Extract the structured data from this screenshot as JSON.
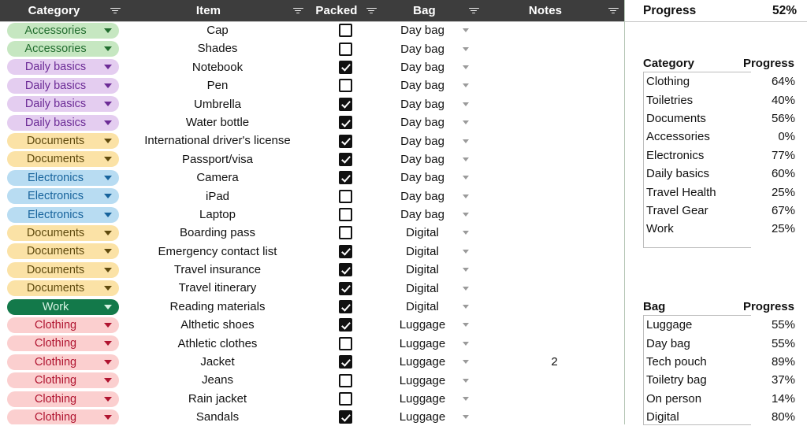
{
  "table": {
    "columns": [
      {
        "key": "category",
        "label": "Category",
        "filter_icon": "filter-icon"
      },
      {
        "key": "item",
        "label": "Item",
        "filter_icon": "filter-icon"
      },
      {
        "key": "packed",
        "label": "Packed",
        "filter_icon": "filter-icon"
      },
      {
        "key": "bag",
        "label": "Bag",
        "filter_icon": "filter-icon"
      },
      {
        "key": "notes",
        "label": "Notes",
        "filter_icon": "filter-icon"
      }
    ],
    "category_colors": {
      "Accessories": {
        "bg": "#c6e7c1",
        "fg": "#216c2e"
      },
      "Daily basics": {
        "bg": "#e4cdf0",
        "fg": "#6c2b96"
      },
      "Documents": {
        "bg": "#fbe2a6",
        "fg": "#5f4a0e"
      },
      "Electronics": {
        "bg": "#b8dcf2",
        "fg": "#17639c"
      },
      "Work": {
        "bg": "#13794a",
        "fg": "#d8f3e3"
      },
      "Clothing": {
        "bg": "#fbcfcf",
        "fg": "#b01430"
      }
    },
    "rows": [
      {
        "category": "Accessories",
        "item": "Cap",
        "packed": false,
        "bag": "Day bag",
        "notes": ""
      },
      {
        "category": "Accessories",
        "item": "Shades",
        "packed": false,
        "bag": "Day bag",
        "notes": ""
      },
      {
        "category": "Daily basics",
        "item": "Notebook",
        "packed": true,
        "bag": "Day bag",
        "notes": ""
      },
      {
        "category": "Daily basics",
        "item": "Pen",
        "packed": false,
        "bag": "Day bag",
        "notes": ""
      },
      {
        "category": "Daily basics",
        "item": "Umbrella",
        "packed": true,
        "bag": "Day bag",
        "notes": ""
      },
      {
        "category": "Daily basics",
        "item": "Water bottle",
        "packed": true,
        "bag": "Day bag",
        "notes": ""
      },
      {
        "category": "Documents",
        "item": "International driver's license",
        "packed": true,
        "bag": "Day bag",
        "notes": ""
      },
      {
        "category": "Documents",
        "item": "Passport/visa",
        "packed": true,
        "bag": "Day bag",
        "notes": ""
      },
      {
        "category": "Electronics",
        "item": "Camera",
        "packed": true,
        "bag": "Day bag",
        "notes": ""
      },
      {
        "category": "Electronics",
        "item": "iPad",
        "packed": false,
        "bag": "Day bag",
        "notes": ""
      },
      {
        "category": "Electronics",
        "item": "Laptop",
        "packed": false,
        "bag": "Day bag",
        "notes": ""
      },
      {
        "category": "Documents",
        "item": "Boarding pass",
        "packed": false,
        "bag": "Digital",
        "notes": ""
      },
      {
        "category": "Documents",
        "item": "Emergency contact list",
        "packed": true,
        "bag": "Digital",
        "notes": ""
      },
      {
        "category": "Documents",
        "item": "Travel insurance",
        "packed": true,
        "bag": "Digital",
        "notes": ""
      },
      {
        "category": "Documents",
        "item": "Travel itinerary",
        "packed": true,
        "bag": "Digital",
        "notes": ""
      },
      {
        "category": "Work",
        "item": "Reading materials",
        "packed": true,
        "bag": "Digital",
        "notes": ""
      },
      {
        "category": "Clothing",
        "item": "Althetic shoes",
        "packed": true,
        "bag": "Luggage",
        "notes": ""
      },
      {
        "category": "Clothing",
        "item": "Athletic clothes",
        "packed": false,
        "bag": "Luggage",
        "notes": ""
      },
      {
        "category": "Clothing",
        "item": "Jacket",
        "packed": true,
        "bag": "Luggage",
        "notes": "2"
      },
      {
        "category": "Clothing",
        "item": "Jeans",
        "packed": false,
        "bag": "Luggage",
        "notes": ""
      },
      {
        "category": "Clothing",
        "item": "Rain jacket",
        "packed": false,
        "bag": "Luggage",
        "notes": ""
      },
      {
        "category": "Clothing",
        "item": "Sandals",
        "packed": true,
        "bag": "Luggage",
        "notes": ""
      }
    ]
  },
  "panel": {
    "overall": {
      "label": "Progress",
      "value": "52%"
    },
    "category_summary": {
      "header": {
        "name": "Category",
        "progress": "Progress"
      },
      "rows": [
        {
          "name": "Clothing",
          "progress": "64%"
        },
        {
          "name": "Toiletries",
          "progress": "40%"
        },
        {
          "name": "Documents",
          "progress": "56%"
        },
        {
          "name": "Accessories",
          "progress": "0%"
        },
        {
          "name": "Electronics",
          "progress": "77%"
        },
        {
          "name": "Daily basics",
          "progress": "60%"
        },
        {
          "name": "Travel Health",
          "progress": "25%"
        },
        {
          "name": "Travel Gear",
          "progress": "67%"
        },
        {
          "name": "Work",
          "progress": "25%"
        }
      ]
    },
    "bag_summary": {
      "header": {
        "name": "Bag",
        "progress": "Progress"
      },
      "rows": [
        {
          "name": "Luggage",
          "progress": "55%"
        },
        {
          "name": "Day bag",
          "progress": "55%"
        },
        {
          "name": "Tech pouch",
          "progress": "89%"
        },
        {
          "name": "Toiletry bag",
          "progress": "37%"
        },
        {
          "name": "On person",
          "progress": "14%"
        },
        {
          "name": "Digital",
          "progress": "80%"
        }
      ]
    }
  }
}
